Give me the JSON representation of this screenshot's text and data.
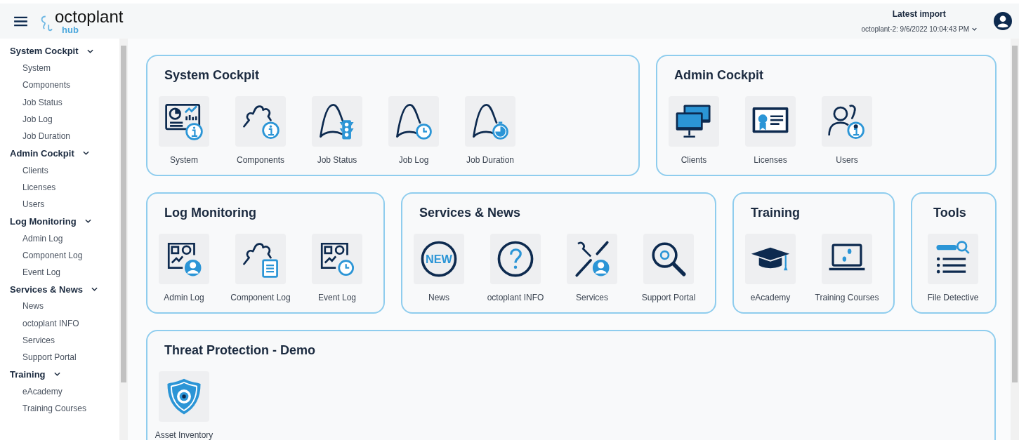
{
  "header": {
    "logo": "octoplant",
    "logo_sub": "hub",
    "import_title": "Latest import",
    "import_value": "octoplant-2: 9/6/2022 10:04:43 PM"
  },
  "sidebar": {
    "sections": [
      {
        "label": "System Cockpit",
        "expanded": true,
        "items": [
          "System",
          "Components",
          "Job Status",
          "Job Log",
          "Job Duration"
        ]
      },
      {
        "label": "Admin Cockpit",
        "expanded": true,
        "items": [
          "Clients",
          "Licenses",
          "Users"
        ]
      },
      {
        "label": "Log Monitoring",
        "expanded": true,
        "items": [
          "Admin Log",
          "Component Log",
          "Event Log"
        ]
      },
      {
        "label": "Services & News",
        "expanded": true,
        "items": [
          "News",
          "octoplant INFO",
          "Services",
          "Support Portal"
        ]
      },
      {
        "label": "Training",
        "expanded": true,
        "items": [
          "eAcademy",
          "Training Courses"
        ]
      }
    ]
  },
  "cards": [
    {
      "title": "System Cockpit",
      "tiles": [
        {
          "label": "System"
        },
        {
          "label": "Components"
        },
        {
          "label": "Job Status"
        },
        {
          "label": "Job Log"
        },
        {
          "label": "Job Duration"
        }
      ]
    },
    {
      "title": "Admin Cockpit",
      "tiles": [
        {
          "label": "Clients"
        },
        {
          "label": "Licenses"
        },
        {
          "label": "Users"
        }
      ]
    },
    {
      "title": "Log Monitoring",
      "tiles": [
        {
          "label": "Admin Log"
        },
        {
          "label": "Component Log"
        },
        {
          "label": "Event Log"
        }
      ]
    },
    {
      "title": "Services & News",
      "tiles": [
        {
          "label": "News",
          "icon_text": "NEW"
        },
        {
          "label": "octoplant INFO"
        },
        {
          "label": "Services"
        },
        {
          "label": "Support Portal"
        }
      ]
    },
    {
      "title": "Training",
      "tiles": [
        {
          "label": "eAcademy"
        },
        {
          "label": "Training Courses"
        }
      ]
    },
    {
      "title": "Tools",
      "tiles": [
        {
          "label": "File Detective"
        }
      ]
    },
    {
      "title": "Threat Protection - Demo",
      "tiles": [
        {
          "label": "Asset Inventory"
        }
      ]
    }
  ]
}
